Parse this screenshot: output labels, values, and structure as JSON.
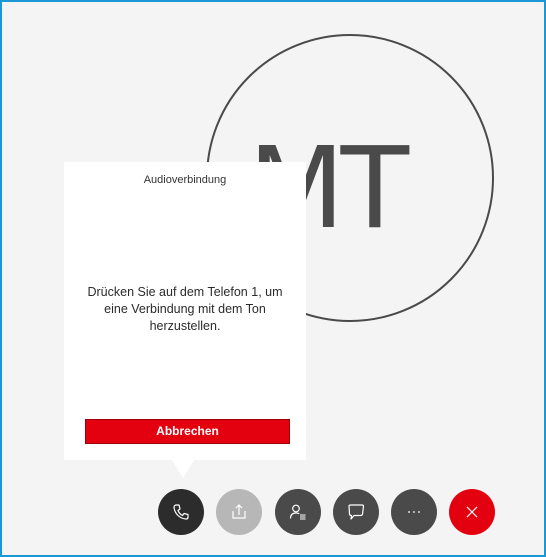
{
  "avatar": {
    "initials": "MT"
  },
  "audio_dialog": {
    "title": "Audioverbindung",
    "message": "Drücken Sie auf dem Telefon 1, um eine Verbindung mit dem Ton herzustellen.",
    "cancel_label": "Abbrechen"
  },
  "controls": [
    {
      "name": "phone",
      "icon": "phone-icon",
      "state": "active"
    },
    {
      "name": "share",
      "icon": "share-icon",
      "state": "disabled"
    },
    {
      "name": "participants",
      "icon": "participants-icon",
      "state": "enabled"
    },
    {
      "name": "chat",
      "icon": "chat-icon",
      "state": "enabled"
    },
    {
      "name": "more",
      "icon": "more-icon",
      "state": "enabled"
    },
    {
      "name": "hangup",
      "icon": "close-icon",
      "state": "enabled"
    }
  ],
  "colors": {
    "frame_border": "#1b97d6",
    "background": "#f4f4f4",
    "accent_red": "#e3000f",
    "dark_button": "#4a4a4a",
    "disabled_button": "#b7b7b7"
  }
}
